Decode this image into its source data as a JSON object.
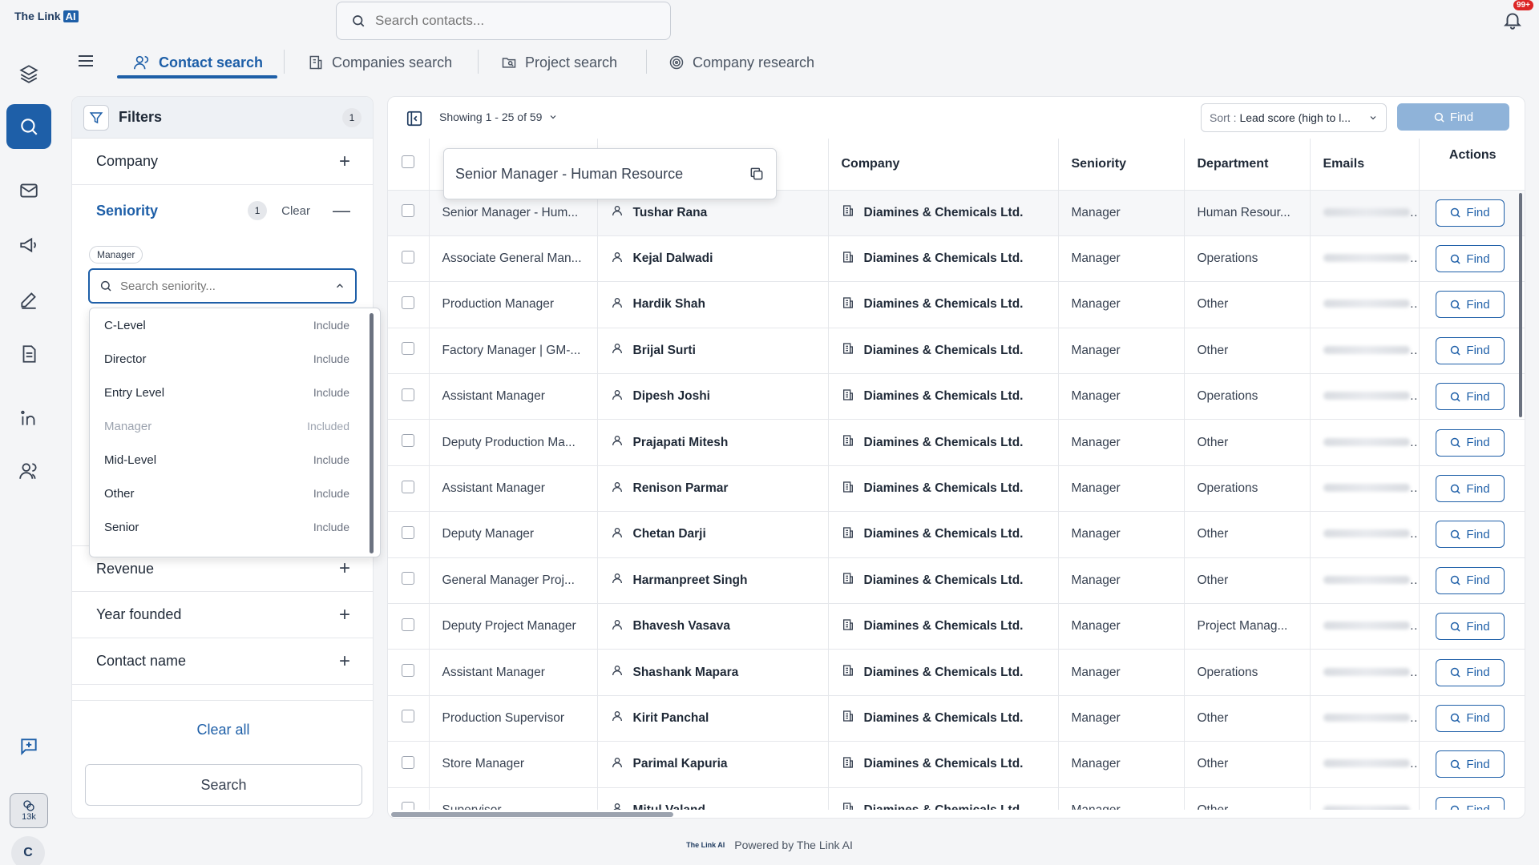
{
  "brand": {
    "name": "The Link",
    "ai": "AI"
  },
  "search": {
    "placeholder": "Search contacts..."
  },
  "notifications": {
    "badge": "99+"
  },
  "credits": {
    "value": "13k"
  },
  "user": {
    "initial": "C"
  },
  "tabs": [
    {
      "label": "Contact search",
      "icon": "contacts-icon",
      "active": true
    },
    {
      "label": "Companies search",
      "icon": "building-icon",
      "active": false
    },
    {
      "label": "Project search",
      "icon": "folder-search-icon",
      "active": false
    },
    {
      "label": "Company research",
      "icon": "research-icon",
      "active": false
    }
  ],
  "filters": {
    "title": "Filters",
    "count": "1",
    "company_label": "Company",
    "seniority": {
      "label": "Seniority",
      "count": "1",
      "clear_label": "Clear",
      "chip": "Manager",
      "search_placeholder": "Search seniority...",
      "options": [
        {
          "label": "C-Level",
          "state": "Include"
        },
        {
          "label": "Director",
          "state": "Include"
        },
        {
          "label": "Entry Level",
          "state": "Include"
        },
        {
          "label": "Manager",
          "state": "Included"
        },
        {
          "label": "Mid-Level",
          "state": "Include"
        },
        {
          "label": "Other",
          "state": "Include"
        },
        {
          "label": "Senior",
          "state": "Include"
        }
      ]
    },
    "revenue_label": "Revenue",
    "year_founded_label": "Year founded",
    "contact_name_label": "Contact name",
    "clear_all_label": "Clear all",
    "search_button_label": "Search"
  },
  "results": {
    "showing": "Showing 1 - 25 of 59",
    "sort_label": "Sort :",
    "sort_value": "Lead score (high to l...",
    "find_label": "Find",
    "tooltip": "Senior Manager - Human Resource",
    "columns": {
      "company": "Company",
      "seniority": "Seniority",
      "department": "Department",
      "emails": "Emails",
      "actions": "Actions"
    },
    "rows": [
      {
        "title": "Senior Manager - Hum...",
        "name": "Tushar Rana",
        "company": "Diamines & Chemicals Ltd.",
        "seniority": "Manager",
        "department": "Human Resour..."
      },
      {
        "title": "Associate General Man...",
        "name": "Kejal Dalwadi",
        "company": "Diamines & Chemicals Ltd.",
        "seniority": "Manager",
        "department": "Operations"
      },
      {
        "title": "Production Manager",
        "name": "Hardik Shah",
        "company": "Diamines & Chemicals Ltd.",
        "seniority": "Manager",
        "department": "Other"
      },
      {
        "title": "Factory Manager | GM-...",
        "name": "Brijal Surti",
        "company": "Diamines & Chemicals Ltd.",
        "seniority": "Manager",
        "department": "Other"
      },
      {
        "title": "Assistant Manager",
        "name": "Dipesh Joshi",
        "company": "Diamines & Chemicals Ltd.",
        "seniority": "Manager",
        "department": "Operations"
      },
      {
        "title": "Deputy Production Ma...",
        "name": "Prajapati Mitesh",
        "company": "Diamines & Chemicals Ltd.",
        "seniority": "Manager",
        "department": "Other"
      },
      {
        "title": "Assistant Manager",
        "name": "Renison Parmar",
        "company": "Diamines & Chemicals Ltd.",
        "seniority": "Manager",
        "department": "Operations"
      },
      {
        "title": "Deputy Manager",
        "name": "Chetan Darji",
        "company": "Diamines & Chemicals Ltd.",
        "seniority": "Manager",
        "department": "Other"
      },
      {
        "title": "General Manager Proj...",
        "name": "Harmanpreet Singh",
        "company": "Diamines & Chemicals Ltd.",
        "seniority": "Manager",
        "department": "Other"
      },
      {
        "title": "Deputy Project Manager",
        "name": "Bhavesh Vasava",
        "company": "Diamines & Chemicals Ltd.",
        "seniority": "Manager",
        "department": "Project Manag..."
      },
      {
        "title": "Assistant Manager",
        "name": "Shashank Mapara",
        "company": "Diamines & Chemicals Ltd.",
        "seniority": "Manager",
        "department": "Operations"
      },
      {
        "title": "Production Supervisor",
        "name": "Kirit Panchal",
        "company": "Diamines & Chemicals Ltd.",
        "seniority": "Manager",
        "department": "Other"
      },
      {
        "title": "Store Manager",
        "name": "Parimal Kapuria",
        "company": "Diamines & Chemicals Ltd.",
        "seniority": "Manager",
        "department": "Other"
      },
      {
        "title": "Supervisor",
        "name": "Mitul Valand",
        "company": "Diamines & Chemicals Ltd.",
        "seniority": "Manager",
        "department": "Other"
      }
    ]
  },
  "footer": {
    "text": "Powered by The Link AI",
    "logo": "The Link AI"
  },
  "colors": {
    "primary": "#1e5fa8",
    "find_disabled": "#8fb3d9"
  }
}
